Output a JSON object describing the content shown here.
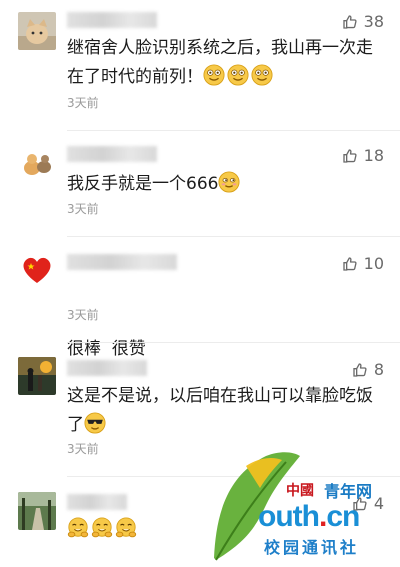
{
  "comments": [
    {
      "avatar": "cat-photo",
      "likes": "38",
      "text_line1": "继宿舍人脸识别系统之后，我山再一次走",
      "text_line2": "在了时代的前列！",
      "emojis": [
        "grinning-face",
        "grinning-face",
        "grinning-face"
      ],
      "time": "3天前"
    },
    {
      "avatar": "cartoon-animals",
      "likes": "18",
      "text_line1": "我反手就是一个666",
      "emojis": [
        "smirking-face"
      ],
      "time": "3天前"
    },
    {
      "avatar": "red-heart-china-flag",
      "likes": "10",
      "text_line1": "很棒  很赞",
      "time": "3天前"
    },
    {
      "avatar": "sunset-photo",
      "likes": "8",
      "text_line1": "这是不是说，以后咱在我山可以靠脸吃饭",
      "text_line2": "了",
      "emojis": [
        "sunglasses-face"
      ],
      "time": "3天前"
    },
    {
      "avatar": "forest-path-photo",
      "likes": "4",
      "emojis": [
        "hugging-face",
        "hugging-face",
        "hugging-face"
      ]
    }
  ],
  "watermark": {
    "china": "中國",
    "youth": "青年网",
    "url_prefix": "outh",
    "url_dot": ".",
    "url_suffix": "cn",
    "school": "校园通讯社"
  },
  "colors": {
    "like_icon": "#6a6a6a",
    "time_text": "#9a9a9a",
    "watermark_blue": "#1a8fd6",
    "watermark_red": "#c8161d",
    "ginkgo_green": "#5cab2e",
    "ginkgo_yellow": "#f0c020"
  }
}
